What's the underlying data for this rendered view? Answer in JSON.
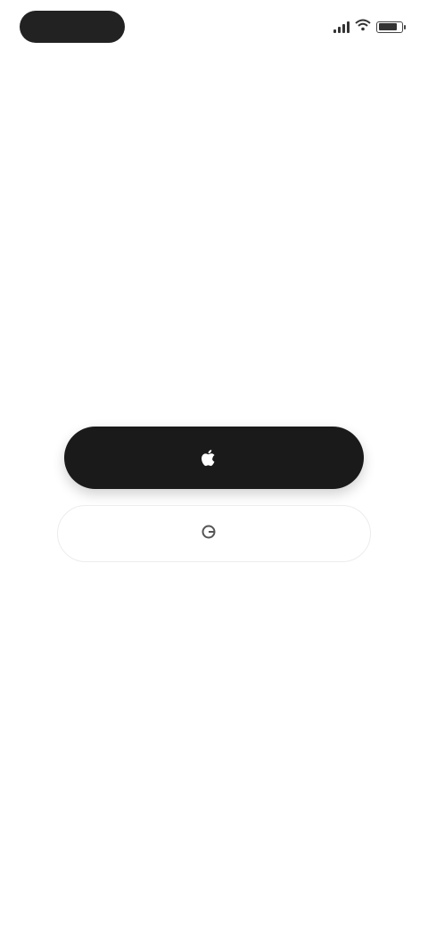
{
  "status_bar": {
    "time": "",
    "signal_icon": "signal-bars-icon",
    "wifi_icon": "wifi-icon",
    "battery_icon": "battery-icon",
    "battery_level": 0.85
  },
  "header": {
    "banner_text": ""
  },
  "main": {
    "title": "",
    "subtitle": ""
  },
  "buttons": {
    "primary_icon": "apple-logo-icon",
    "primary_label": "",
    "secondary_icon": "google-logo-icon",
    "secondary_label": ""
  },
  "link": {
    "label": ""
  },
  "terms": {
    "prefix": "",
    "terms_link": "",
    "middle": "",
    "privacy_link": ""
  },
  "colors": {
    "primary_button_bg": "#1a1a1a",
    "page_bg": "#ffffff"
  }
}
